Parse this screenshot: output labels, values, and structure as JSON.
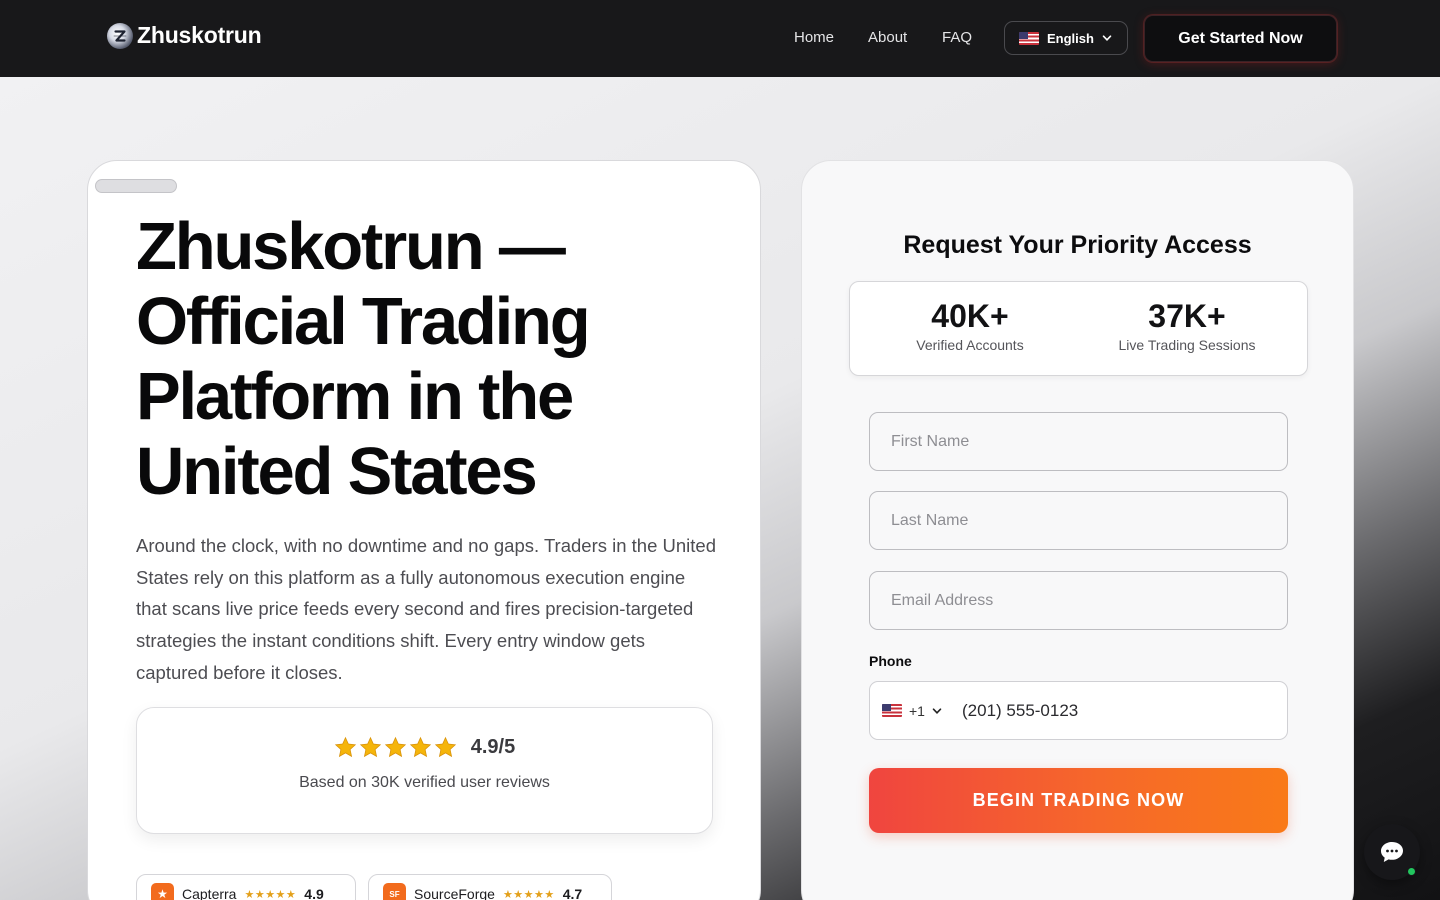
{
  "brand": {
    "name": "Zhuskotrun"
  },
  "nav": {
    "links": [
      "Home",
      "About",
      "FAQ"
    ],
    "language": "English",
    "cta_label": "Get Started Now"
  },
  "hero": {
    "title": "Zhuskotrun — Official Trading Platform in the United States",
    "description": "Around the clock, with no downtime and no gaps. Traders in the United States rely on this platform as a fully autonomous execution engine that scans live price feeds every second and fires precision-targeted strategies the instant conditions shift. Every entry window gets captured before it closes.",
    "rating": {
      "stars": 5,
      "score": "4.9/5",
      "reviews_text": "Based on 30K verified user reviews"
    },
    "badges": [
      {
        "name": "Capterra",
        "score": "4.9",
        "icon": "★"
      },
      {
        "name": "SourceForge",
        "score": "4.7",
        "icon": "SF"
      }
    ]
  },
  "form": {
    "title": "Request Your Priority Access",
    "stats": [
      {
        "value": "40K+",
        "label": "Verified Accounts"
      },
      {
        "value": "37K+",
        "label": "Live Trading Sessions"
      }
    ],
    "first_name_placeholder": "First Name",
    "last_name_placeholder": "Last Name",
    "email_placeholder": "Email Address",
    "phone_label": "Phone",
    "country_code": "+1",
    "phone_placeholder": "(201) 555-0123",
    "submit_label": "BEGIN TRADING NOW"
  },
  "colors": {
    "nav_bg": "#18181a",
    "accent_start": "#f0453f",
    "accent_end": "#f97a18",
    "star": "#f5b50a",
    "online": "#22c55e"
  },
  "icons": {
    "logo": "z-coin-logo-icon",
    "flag": "us-flag-icon",
    "chevron": "chevron-down-icon",
    "star": "star-icon",
    "chat": "chat-bubble-icon"
  }
}
